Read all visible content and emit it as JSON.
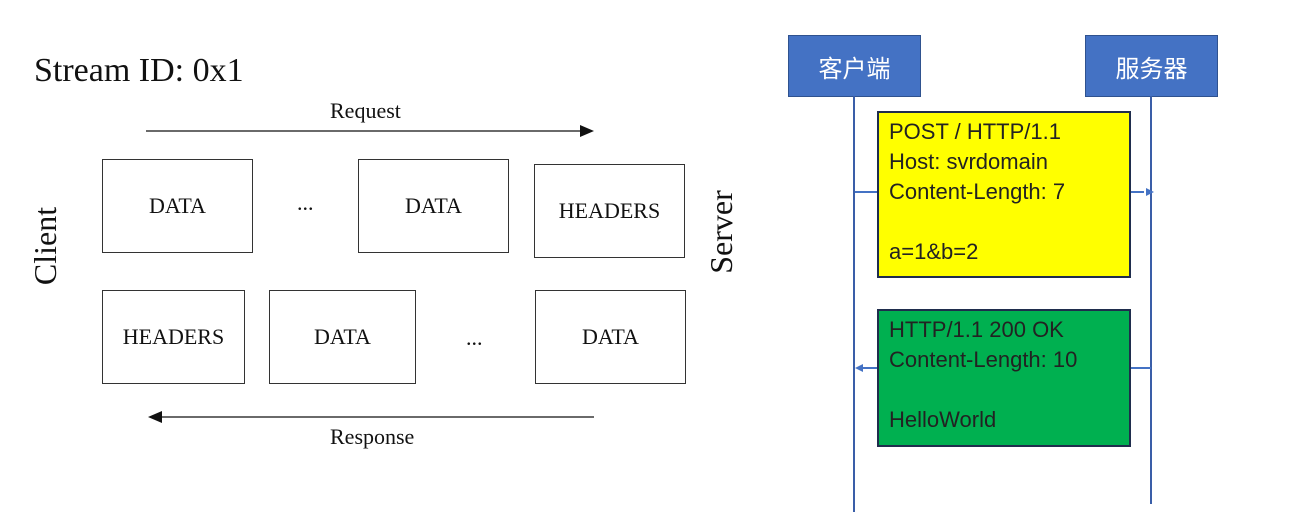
{
  "stream_diagram": {
    "title": "Stream ID: 0x1",
    "request_label": "Request",
    "response_label": "Response",
    "client_label": "Client",
    "server_label": "Server",
    "request_frames": [
      "DATA",
      "...",
      "DATA",
      "HEADERS"
    ],
    "response_frames": [
      "HEADERS",
      "DATA",
      "...",
      "DATA"
    ]
  },
  "sequence_diagram": {
    "client_actor": "客户端",
    "server_actor": "服务器",
    "request": {
      "lines": [
        "POST / HTTP/1.1",
        "Host: svrdomain",
        "Content-Length: 7",
        "",
        "a=1&b=2"
      ],
      "color": "#FFFF00"
    },
    "response": {
      "lines": [
        "HTTP/1.1 200 OK",
        "Content-Length: 10",
        "",
        "HelloWorld"
      ],
      "color": "#00B050"
    },
    "actor_color": "#4472C4"
  }
}
